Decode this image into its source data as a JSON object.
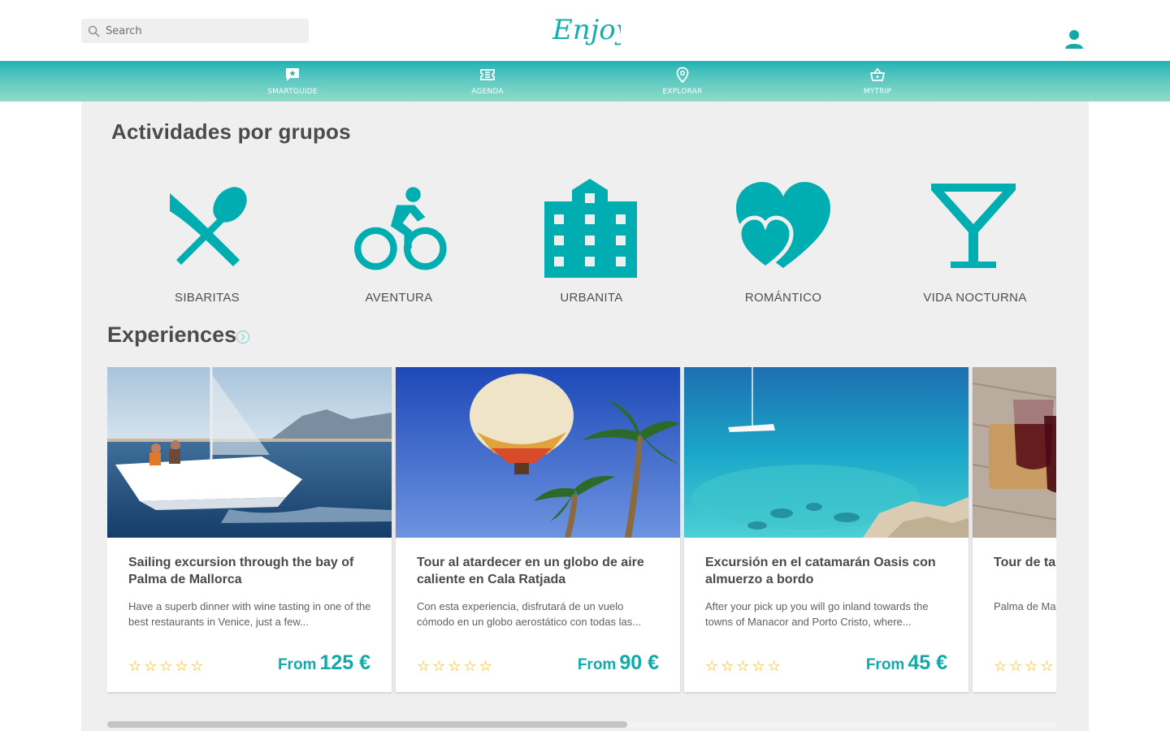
{
  "header": {
    "search_placeholder": "Search",
    "logo_text": "Enjoy"
  },
  "nav": {
    "items": [
      {
        "label": "SMARTGUIDE",
        "icon": "chat-star-icon"
      },
      {
        "label": "AGENDA",
        "icon": "ticket-icon"
      },
      {
        "label": "EXPLORAR",
        "icon": "map-pin-icon"
      },
      {
        "label": "MYTRIP",
        "icon": "basket-icon"
      }
    ]
  },
  "groups": {
    "title": "Actividades por grupos",
    "items": [
      {
        "label": "SIBARITAS",
        "icon": "knife-spoon-icon"
      },
      {
        "label": "AVENTURA",
        "icon": "cyclist-icon"
      },
      {
        "label": "URBANITA",
        "icon": "building-icon"
      },
      {
        "label": "ROMÁNTICO",
        "icon": "hearts-icon"
      },
      {
        "label": "VIDA NOCTURNA",
        "icon": "cocktail-glass-icon"
      }
    ]
  },
  "experiences": {
    "title": "Experiences",
    "cards": [
      {
        "title": "Sailing excursion through the bay of Palma de Mallorca",
        "description": "Have a superb dinner with wine tasting in one of the best restaurants in Venice, just a few...",
        "stars": "☆☆☆☆☆",
        "price_prefix": "From",
        "price": "125 €"
      },
      {
        "title": "Tour al atardecer en un globo de aire caliente en Cala Ratjada",
        "description": "Con esta experiencia, disfrutará de un vuelo cómodo en un globo aerostático con todas las...",
        "stars": "☆☆☆☆☆",
        "price_prefix": "From",
        "price": "90 €"
      },
      {
        "title": "Excursión en el catamarán Oasis con almuerzo a bordo",
        "description": "After your pick up you will go inland towards the towns of Manacor and Porto Cristo, where...",
        "stars": "☆☆☆☆☆",
        "price_prefix": "From",
        "price": "45 €"
      },
      {
        "title": "Tour de ta casco anti",
        "description": "Palma de Ma tiempo. Esto",
        "stars": "☆☆☆☆☆",
        "price_prefix": "",
        "price": ""
      }
    ]
  },
  "colors": {
    "accent": "#12aaa8",
    "icon_teal": "#00adb1",
    "star": "#f2b705",
    "content_bg": "#efefef"
  }
}
